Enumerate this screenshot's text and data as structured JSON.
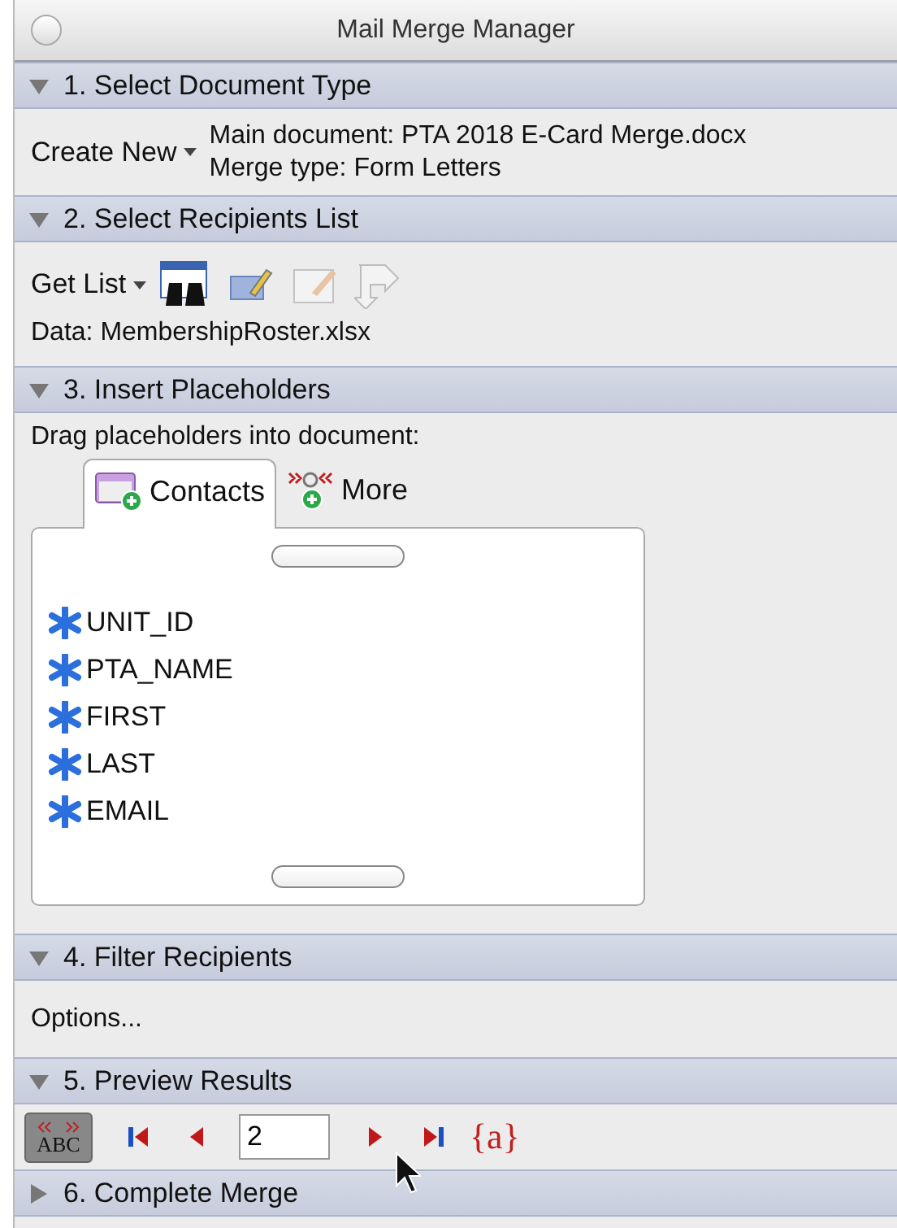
{
  "window": {
    "title": "Mail Merge Manager"
  },
  "sections": [
    {
      "kind": "document",
      "title": "1. Select Document Type",
      "expanded": true,
      "menu": "Create New",
      "lines": [
        "Main document: PTA 2018 E-Card Merge.docx",
        "Merge type: Form Letters"
      ]
    },
    {
      "kind": "recipients",
      "title": "2. Select Recipients List",
      "expanded": true,
      "menu": "Get List",
      "data": "Data: MembershipRoster.xlsx"
    },
    {
      "kind": "placeholders",
      "title": "3. Insert Placeholders",
      "expanded": true,
      "hint": "Drag placeholders into document:",
      "tabs": [
        {
          "label": "Contacts",
          "selected": true
        },
        {
          "label": "More",
          "selected": false
        }
      ],
      "fields": [
        "UNIT_ID",
        "PTA_NAME",
        "FIRST",
        "LAST",
        "EMAIL"
      ]
    },
    {
      "kind": "filter",
      "title": "4. Filter Recipients",
      "expanded": true,
      "options": "Options..."
    },
    {
      "kind": "preview",
      "title": "5. Preview Results",
      "expanded": true,
      "toggle": {
        "label": "ABC",
        "on": true
      },
      "record": "2",
      "fields_button": "{a}"
    },
    {
      "title": "6. Complete Merge",
      "expanded": false
    }
  ]
}
